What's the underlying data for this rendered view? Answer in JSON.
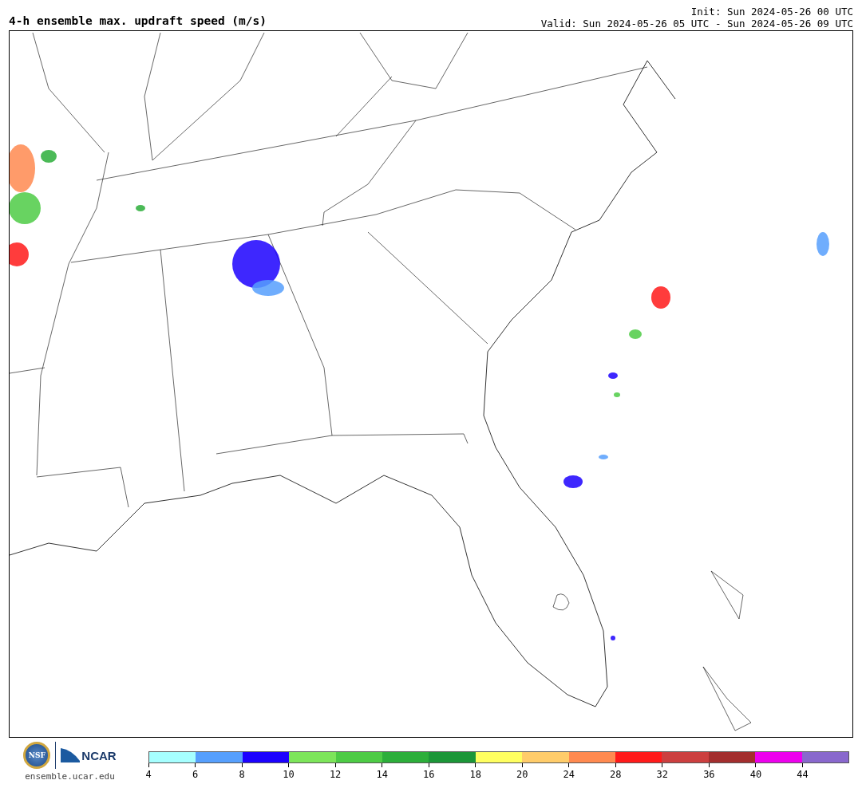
{
  "header": {
    "title": "4-h ensemble max. updraft speed (m/s)",
    "init": "Init: Sun 2024-05-26 00 UTC",
    "valid": "Valid: Sun 2024-05-26 05 UTC - Sun 2024-05-26 09 UTC"
  },
  "footer": {
    "logo_left": "NSF",
    "logo_right": "NCAR",
    "site": "ensemble.ucar.edu"
  },
  "colorbar": {
    "bins": [
      {
        "color": "#a6ffff",
        "tick": "4"
      },
      {
        "color": "#569ffd",
        "tick": "6"
      },
      {
        "color": "#1c01fe",
        "tick": "8"
      },
      {
        "color": "#7de55a",
        "tick": "10"
      },
      {
        "color": "#4dcb45",
        "tick": "12"
      },
      {
        "color": "#2cae3a",
        "tick": "14"
      },
      {
        "color": "#1c9638",
        "tick": "16"
      },
      {
        "color": "#ffff60",
        "tick": "18"
      },
      {
        "color": "#ffcc6a",
        "tick": "20"
      },
      {
        "color": "#ff8a50",
        "tick": "24"
      },
      {
        "color": "#ff1a1a",
        "tick": "28"
      },
      {
        "color": "#cc3f3f",
        "tick": "32"
      },
      {
        "color": "#a32e2e",
        "tick": "36"
      },
      {
        "color": "#ed00ed",
        "tick": "40"
      },
      {
        "color": "#8968cd",
        "tick": "44"
      }
    ]
  }
}
